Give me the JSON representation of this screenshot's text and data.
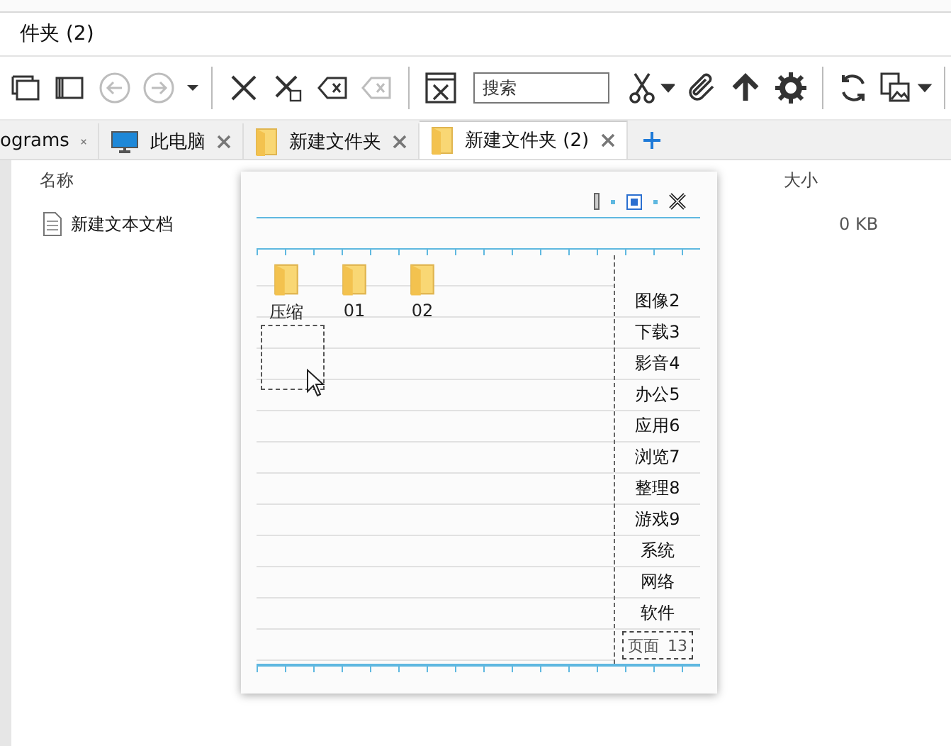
{
  "window": {
    "title": "件夹 (2)"
  },
  "toolbar": [
    {
      "kind": "cascade",
      "disabled": false
    },
    {
      "kind": "panes",
      "disabled": false
    },
    {
      "kind": "back",
      "disabled": true
    },
    {
      "kind": "forward",
      "disabled": true
    },
    {
      "kind": "caret",
      "disabled": false
    },
    {
      "kind": "sep"
    },
    {
      "kind": "cross",
      "disabled": false
    },
    {
      "kind": "crosscopy",
      "disabled": false
    },
    {
      "kind": "erase",
      "disabled": false
    },
    {
      "kind": "erase",
      "disabled": true
    },
    {
      "kind": "sep"
    },
    {
      "kind": "winclose",
      "disabled": false
    },
    {
      "kind": "search",
      "placeholder": "搜索"
    },
    {
      "kind": "scissors",
      "disabled": false
    },
    {
      "kind": "clip",
      "disabled": false
    },
    {
      "kind": "up",
      "disabled": false
    },
    {
      "kind": "gear",
      "disabled": false
    },
    {
      "kind": "sep"
    },
    {
      "kind": "refresh",
      "disabled": false
    },
    {
      "kind": "image",
      "disabled": false
    },
    {
      "kind": "sep"
    }
  ],
  "tabs": [
    {
      "label": "ograms",
      "kind": "plain",
      "selected": false
    },
    {
      "label": "此电脑",
      "kind": "computer",
      "selected": false
    },
    {
      "label": "新建文件夹",
      "kind": "folder",
      "selected": false
    },
    {
      "label": "新建文件夹 (2)",
      "kind": "folder",
      "selected": true
    }
  ],
  "file_list": {
    "columns": [
      {
        "label": "名称",
        "kind": "name"
      },
      {
        "label": "大小",
        "kind": "size"
      }
    ],
    "rows": [
      {
        "name": "新建文本文档",
        "size": "0 KB"
      }
    ]
  },
  "popup": {
    "folders": [
      "压缩",
      "01",
      "02"
    ],
    "sidebar": [
      "图像2",
      "下载3",
      "影音4",
      "办公5",
      "应用6",
      "浏览7",
      "整理8",
      "游戏9",
      "系统",
      "网络",
      "软件"
    ],
    "page_box": {
      "label": "页面",
      "number": "13"
    }
  }
}
